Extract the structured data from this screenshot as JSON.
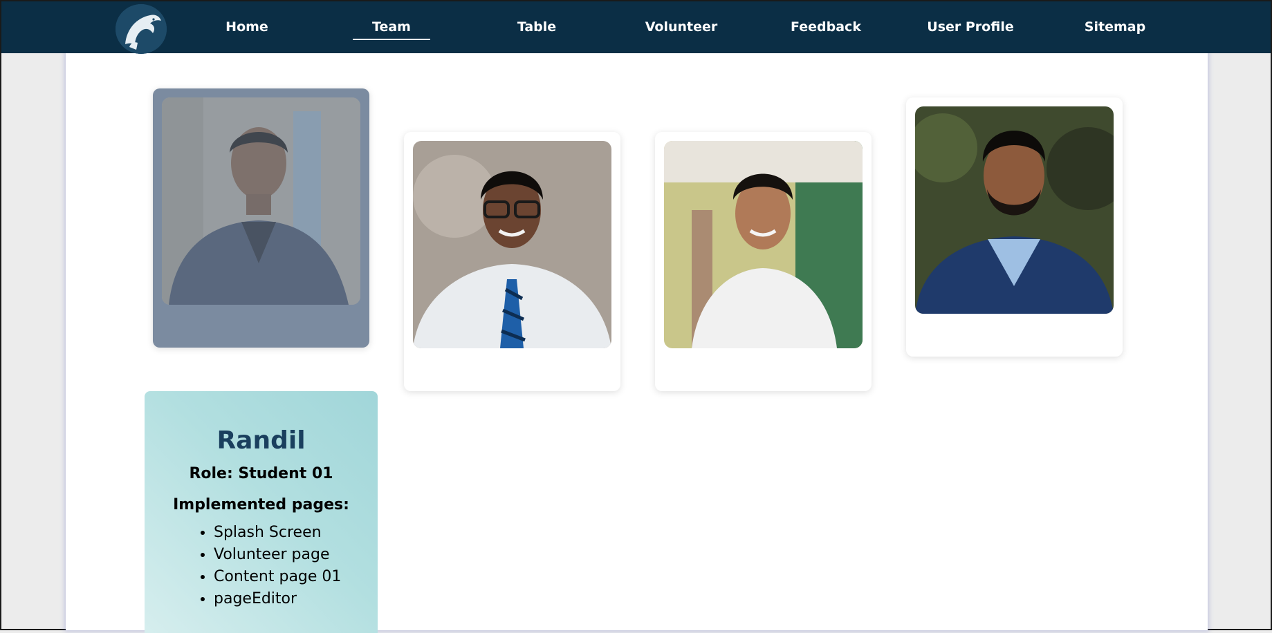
{
  "nav": {
    "items": [
      {
        "label": "Home"
      },
      {
        "label": "Team"
      },
      {
        "label": "Table"
      },
      {
        "label": "Volunteer"
      },
      {
        "label": "Feedback"
      },
      {
        "label": "User Profile"
      },
      {
        "label": "Sitemap"
      }
    ],
    "active": "Team",
    "logo_icon": "dolphin-logo-icon"
  },
  "team": {
    "members": [
      {
        "photo": "member-photo-1",
        "selected": true
      },
      {
        "photo": "member-photo-2",
        "selected": false
      },
      {
        "photo": "member-photo-3",
        "selected": false
      },
      {
        "photo": "member-photo-4",
        "selected": false
      }
    ],
    "selected_info": {
      "name": "Randil",
      "role": "Role: Student 01",
      "pages_title": "Implemented pages:",
      "pages": [
        "Splash Screen",
        "Volunteer page",
        "Content page 01",
        "pageEditor"
      ]
    }
  },
  "colors": {
    "navbar": "#0b2e45",
    "active_card": "#7b8ba0",
    "name": "#1a3f5e",
    "info_gradient_start": "#d6eeee",
    "info_gradient_end": "#a1d6d9"
  }
}
